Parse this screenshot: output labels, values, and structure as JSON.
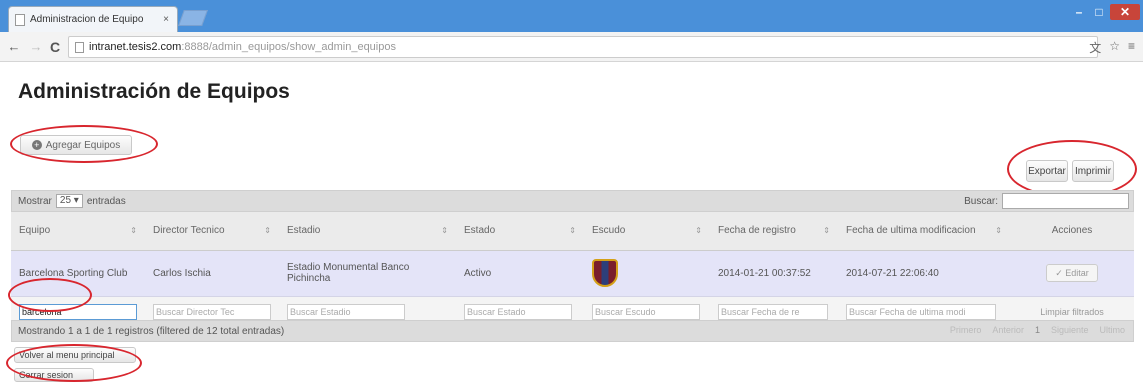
{
  "browser": {
    "tab_title": "Administracion de Equipo",
    "tab_close": "×",
    "url_host": "intranet.tesis2.com",
    "url_path": ":8888/admin_equipos/show_admin_equipos",
    "back_icon": "←",
    "forward_icon": "→",
    "reload_icon": "C",
    "translate_icon": "文",
    "star_icon": "☆",
    "menu_icon": "≡",
    "win_min": "–",
    "win_max": "□",
    "win_close": "✕"
  },
  "page": {
    "title": "Administración de Equipos",
    "add_button": "Agregar Equipos",
    "add_icon": "+",
    "export_button": "Exportar",
    "print_button": "Imprimir",
    "show_label": "Mostrar",
    "show_value": "25 ▾",
    "entries_label": "entradas",
    "search_label": "Buscar:"
  },
  "table": {
    "sort_icon": "⇕",
    "columns": [
      "Equipo",
      "Director Tecnico",
      "Estadio",
      "Estado",
      "Escudo",
      "Fecha de registro",
      "Fecha de ultima modificacion",
      "Acciones"
    ],
    "rows": [
      {
        "equipo": "Barcelona Sporting Club",
        "director": "Carlos Ischia",
        "estadio": "Estadio Monumental Banco Pichincha",
        "estado": "Activo",
        "registro": "2014-01-21 00:37:52",
        "modificacion": "2014-07-21 22:06:40",
        "edit": "✓ Editar"
      }
    ],
    "filters": {
      "equipo": "barcelona",
      "director": "Buscar Director Tec",
      "estadio": "Buscar Estadio",
      "estado": "Buscar Estado",
      "escudo": "Buscar Escudo",
      "registro": "Buscar Fecha de re",
      "modificacion": "Buscar Fecha de ultima modi",
      "clear": "Limpiar filtrados"
    }
  },
  "footer": {
    "info": "Mostrando 1 a 1 de 1 registros (filtered de 12 total entradas)",
    "first": "Primero",
    "prev": "Anterior",
    "page": "1",
    "next": "Siguiente",
    "last": "Ultimo",
    "back_button": "Volver al menu principal",
    "logout_button": "Cerrar sesion"
  },
  "colors": {
    "annotation_circle": "#d8262e",
    "row_highlight": "#e4e4f8",
    "chrome_blue": "#4a90d9"
  }
}
